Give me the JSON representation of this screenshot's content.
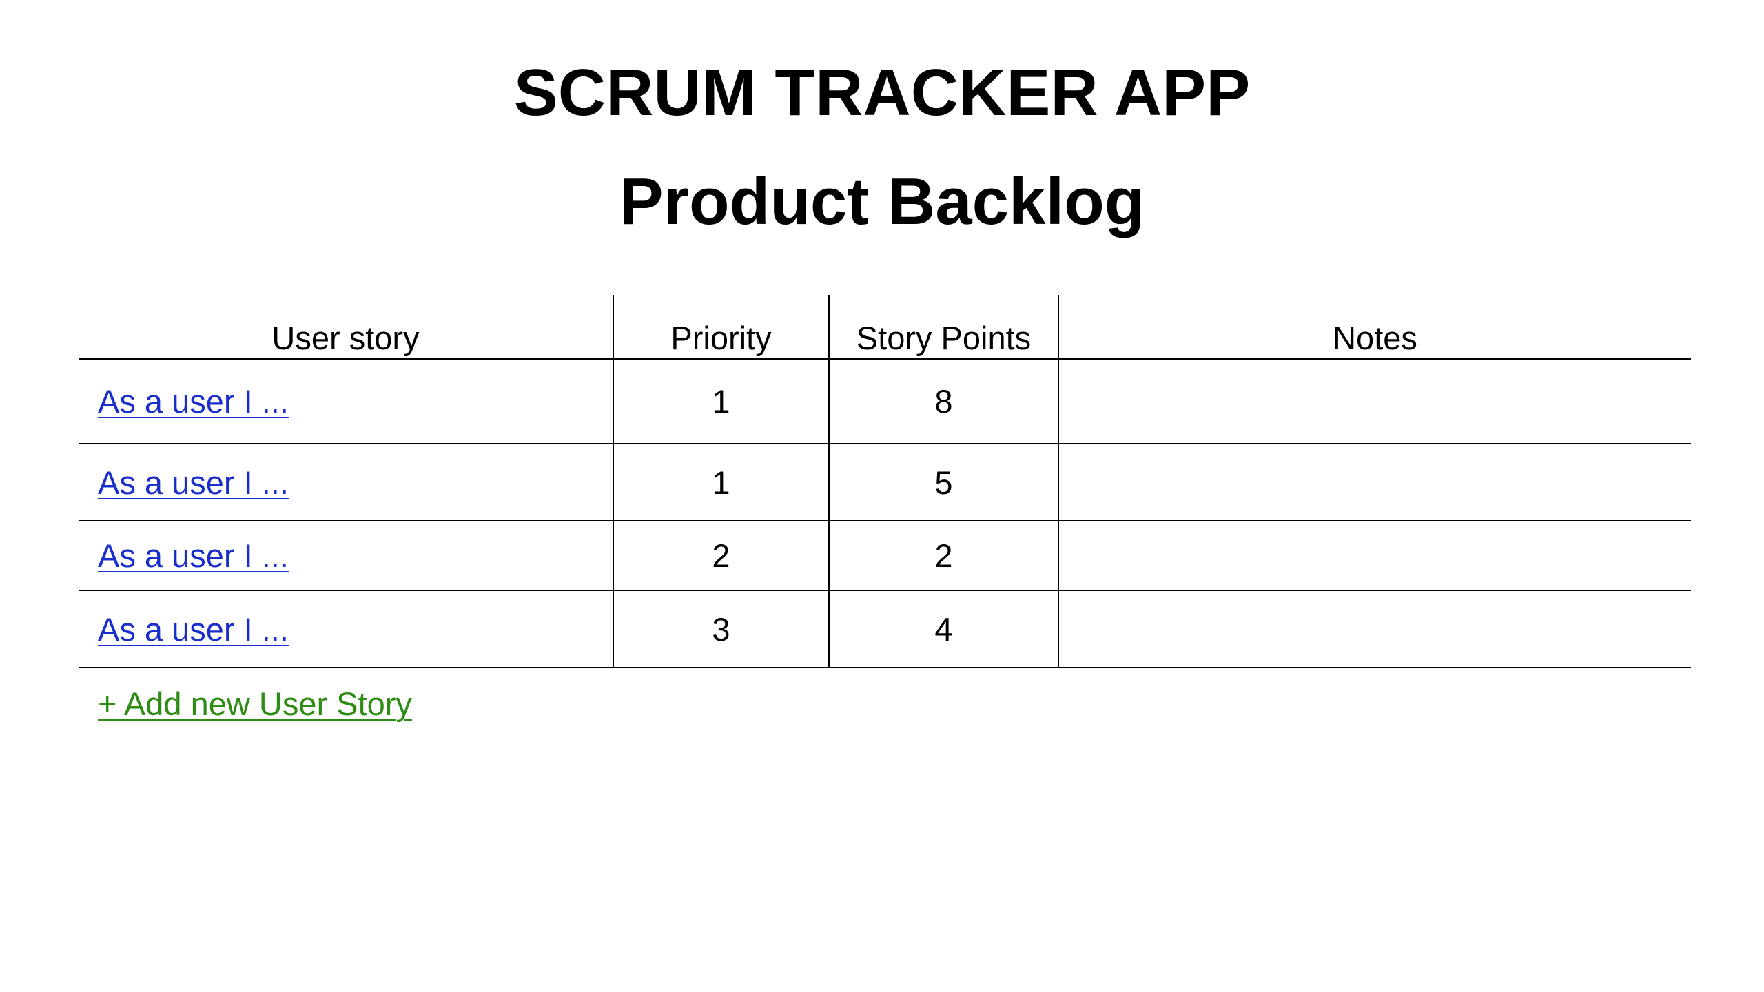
{
  "header": {
    "app_title": "SCRUM TRACKER APP",
    "page_title": "Product Backlog"
  },
  "table": {
    "columns": [
      "User story",
      "Priority",
      "Story Points",
      "Notes"
    ],
    "rows": [
      {
        "story": "As a user I ...",
        "priority": "1",
        "points": "8",
        "notes": ""
      },
      {
        "story": "As a user I ...",
        "priority": "1",
        "points": "5",
        "notes": ""
      },
      {
        "story": "As a user I ...",
        "priority": "2",
        "points": "2",
        "notes": ""
      },
      {
        "story": "As a user I ...",
        "priority": "3",
        "points": "4",
        "notes": ""
      }
    ]
  },
  "actions": {
    "add_story_label": "+ Add new User Story"
  },
  "colors": {
    "link": "#1a2ecc",
    "add_link": "#2e8b14",
    "border": "#000000"
  }
}
